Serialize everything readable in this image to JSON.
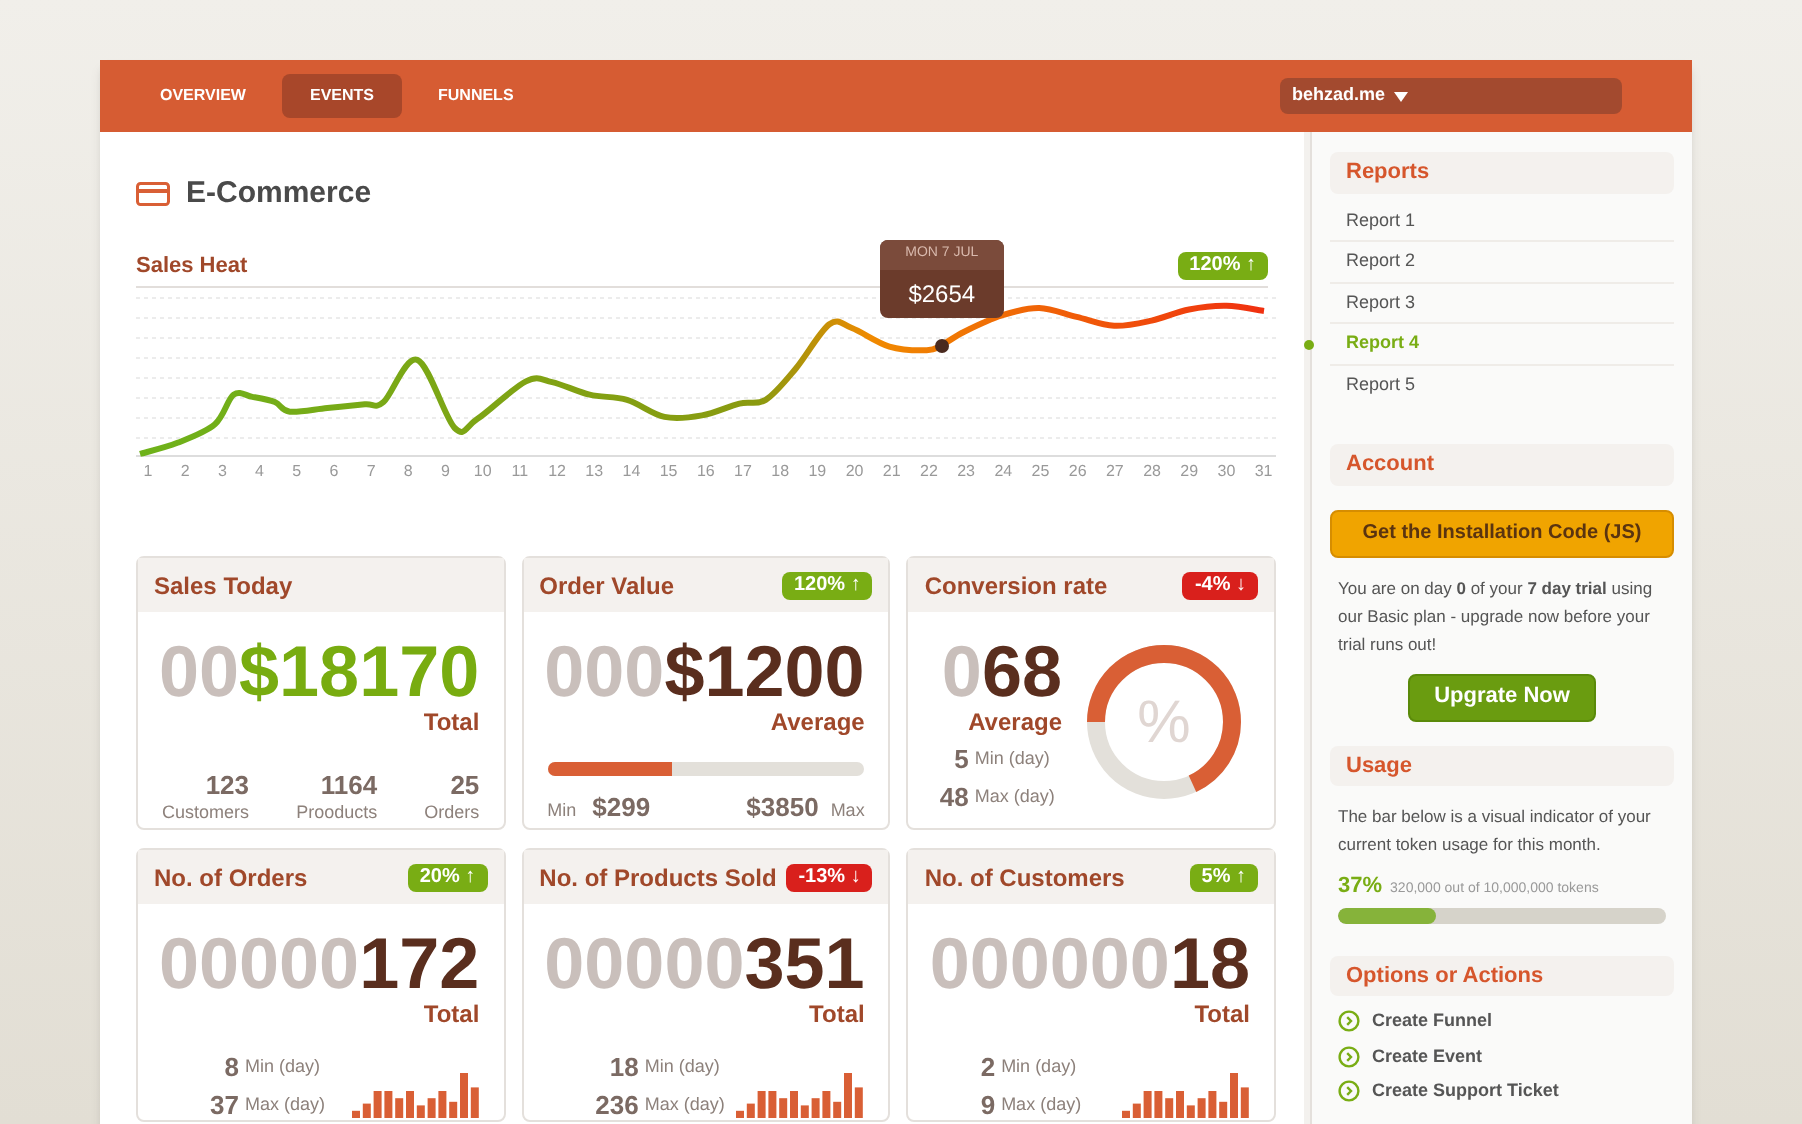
{
  "nav": {
    "tabs": [
      {
        "label": "OVERVIEW",
        "selected": false
      },
      {
        "label": "EVENTS",
        "selected": true
      },
      {
        "label": "FUNNELS",
        "selected": false
      }
    ],
    "account": "behzad.me"
  },
  "page": {
    "title": "E-Commerce"
  },
  "sales_heat": {
    "title": "Sales Heat",
    "badge": {
      "text": "120% ↑",
      "color": "#79ad14"
    },
    "tooltip": {
      "date": "MON 7 JUL",
      "value": "$2654"
    },
    "x_labels": [
      "1",
      "2",
      "3",
      "4",
      "5",
      "6",
      "7",
      "8",
      "9",
      "10",
      "11",
      "12",
      "13",
      "14",
      "15",
      "16",
      "17",
      "18",
      "19",
      "20",
      "21",
      "22",
      "23",
      "24",
      "25",
      "26",
      "27",
      "28",
      "29",
      "30",
      "31"
    ]
  },
  "cards": [
    {
      "kind": "total",
      "title": "Sales Today",
      "ghost": "00",
      "value": "$18170",
      "highlight": true,
      "caption": "Total",
      "stats": [
        {
          "value": "123",
          "label": "Customers"
        },
        {
          "value": "1164",
          "label": "Prooducts"
        },
        {
          "value": "25",
          "label": "Orders"
        }
      ]
    },
    {
      "kind": "range",
      "title": "Order Value",
      "badge": {
        "text": "120% ↑",
        "color": "#79ad14"
      },
      "ghost": "000",
      "value": "$1200",
      "highlight": false,
      "caption": "Average",
      "level": 0.39,
      "min_label": "Min",
      "min": "$299",
      "max": "$3850",
      "max_label": "Max"
    },
    {
      "kind": "donut",
      "title": "Conversion rate",
      "badge": {
        "text": "-4% ↓",
        "color": "#d9201c"
      },
      "ghost": "0",
      "value": "68",
      "highlight": false,
      "caption": "Average",
      "level": 0.68,
      "symbol": "%",
      "rows": [
        {
          "value": "5",
          "label": "Min (day)"
        },
        {
          "value": "48",
          "label": "Max (day)"
        }
      ]
    },
    {
      "kind": "bars",
      "title": "No. of Orders",
      "badge": {
        "text": "20% ↑",
        "color": "#79ad14"
      },
      "ghost": "00000",
      "value": "172",
      "highlight": false,
      "caption": "Total",
      "rows": [
        {
          "value": "8",
          "label": "Min (day)"
        },
        {
          "value": "37",
          "label": "Max (day)"
        }
      ]
    },
    {
      "kind": "bars",
      "title": "No. of Products Sold",
      "badge": {
        "text": "-13% ↓",
        "color": "#d9201c"
      },
      "ghost": "00000",
      "value": "351",
      "highlight": false,
      "caption": "Total",
      "rows": [
        {
          "value": "18",
          "label": "Min (day)"
        },
        {
          "value": "236",
          "label": "Max (day)"
        }
      ]
    },
    {
      "kind": "bars",
      "title": "No. of Customers",
      "badge": {
        "text": "5% ↑",
        "color": "#79ad14"
      },
      "ghost": "000000",
      "value": "18",
      "highlight": false,
      "caption": "Total",
      "rows": [
        {
          "value": "2",
          "label": "Min (day)"
        },
        {
          "value": "9",
          "label": "Max (day)"
        }
      ]
    }
  ],
  "sidebar": {
    "sections": [
      {
        "kind": "links",
        "title": "Reports",
        "items": [
          {
            "label": "Report 1",
            "selected": false
          },
          {
            "label": "Report 2",
            "selected": false
          },
          {
            "label": "Report 3",
            "selected": false
          },
          {
            "label": "Report 4",
            "selected": true
          },
          {
            "label": "Report 5",
            "selected": false
          }
        ]
      },
      {
        "kind": "account",
        "title": "Account",
        "button": "Get the Installation Code (JS)",
        "text": "You are on day **0** of your **7 day trial** using our Basic plan - upgrade now before your trial runs out!",
        "upgrade": "Upgrate Now"
      },
      {
        "kind": "usage",
        "title": "Usage",
        "text": "The bar below is a visual indicator of your current token usage for this month.",
        "percent": "37%",
        "detail": "320,000 out of 10,000,000 tokens",
        "level": 0.3
      },
      {
        "kind": "actions",
        "title": "Options or Actions",
        "items": [
          "Create Funnel",
          "Create Event",
          "Create Support Ticket"
        ]
      }
    ]
  }
}
